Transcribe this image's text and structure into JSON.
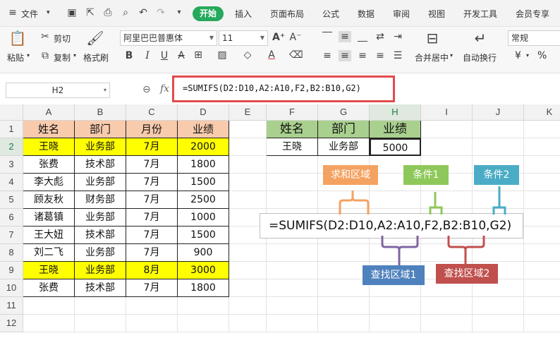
{
  "menubar": {
    "file": "文件",
    "tabs": [
      "开始",
      "插入",
      "页面布局",
      "公式",
      "数据",
      "审阅",
      "视图",
      "开发工具",
      "会员专享"
    ]
  },
  "ribbon": {
    "paste": "粘贴",
    "cut": "剪切",
    "copy": "复制",
    "format_painter": "格式刷",
    "font_name": "阿里巴巴普惠体",
    "font_size": "11",
    "merge_center": "合并居中",
    "wrap_text": "自动换行",
    "number_format": "常规",
    "currency_symbol": "¥",
    "percent_symbol": "%"
  },
  "formula_bar": {
    "name_box": "H2",
    "fx": "fx",
    "formula": "=SUMIFS(D2:D10,A2:A10,F2,B2:B10,G2)"
  },
  "grid": {
    "columns": [
      "A",
      "B",
      "C",
      "D",
      "E",
      "F",
      "G",
      "H",
      "I",
      "J",
      "K"
    ],
    "rows": [
      "1",
      "2",
      "3",
      "4",
      "5",
      "6",
      "7",
      "8",
      "9",
      "10",
      "11",
      "12"
    ],
    "table_header": [
      "姓名",
      "部门",
      "月份",
      "业绩"
    ],
    "table_rows": [
      [
        "王晓",
        "业务部",
        "7月",
        "2000"
      ],
      [
        "张费",
        "技术部",
        "7月",
        "1800"
      ],
      [
        "李大彪",
        "业务部",
        "7月",
        "1500"
      ],
      [
        "顾友秋",
        "财务部",
        "7月",
        "2500"
      ],
      [
        "诸葛镇",
        "业务部",
        "7月",
        "1000"
      ],
      [
        "王大妞",
        "技术部",
        "7月",
        "1500"
      ],
      [
        "刘二飞",
        "业务部",
        "7月",
        "900"
      ],
      [
        "王晓",
        "业务部",
        "8月",
        "3000"
      ],
      [
        "张费",
        "技术部",
        "7月",
        "1800"
      ]
    ],
    "lookup_header": [
      "姓名",
      "部门",
      "业绩"
    ],
    "lookup_row": [
      "王晓",
      "业务部",
      "5000"
    ]
  },
  "annotations": {
    "formula": "=SUMIFS(D2:D10,A2:A10,F2,B2:B10,G2)",
    "sum_range": "求和区域",
    "criteria1": "条件1",
    "criteria2": "条件2",
    "lookup_range1": "查找区域1",
    "lookup_range2": "查找区域2"
  },
  "colors": {
    "accent_green": "#25a95c",
    "header_peach": "#f8cbad",
    "highlight_yellow": "#ffff00",
    "lookup_header_green": "#a9d08e",
    "formula_red_box": "#e24b4b",
    "sum_orange": "#f4a261",
    "crit1_green": "#8fc85a",
    "crit2_teal": "#4bacc6",
    "range1_purple": "#8064a2",
    "range2_red": "#c0504d",
    "label_blue": "#4f81bd"
  }
}
